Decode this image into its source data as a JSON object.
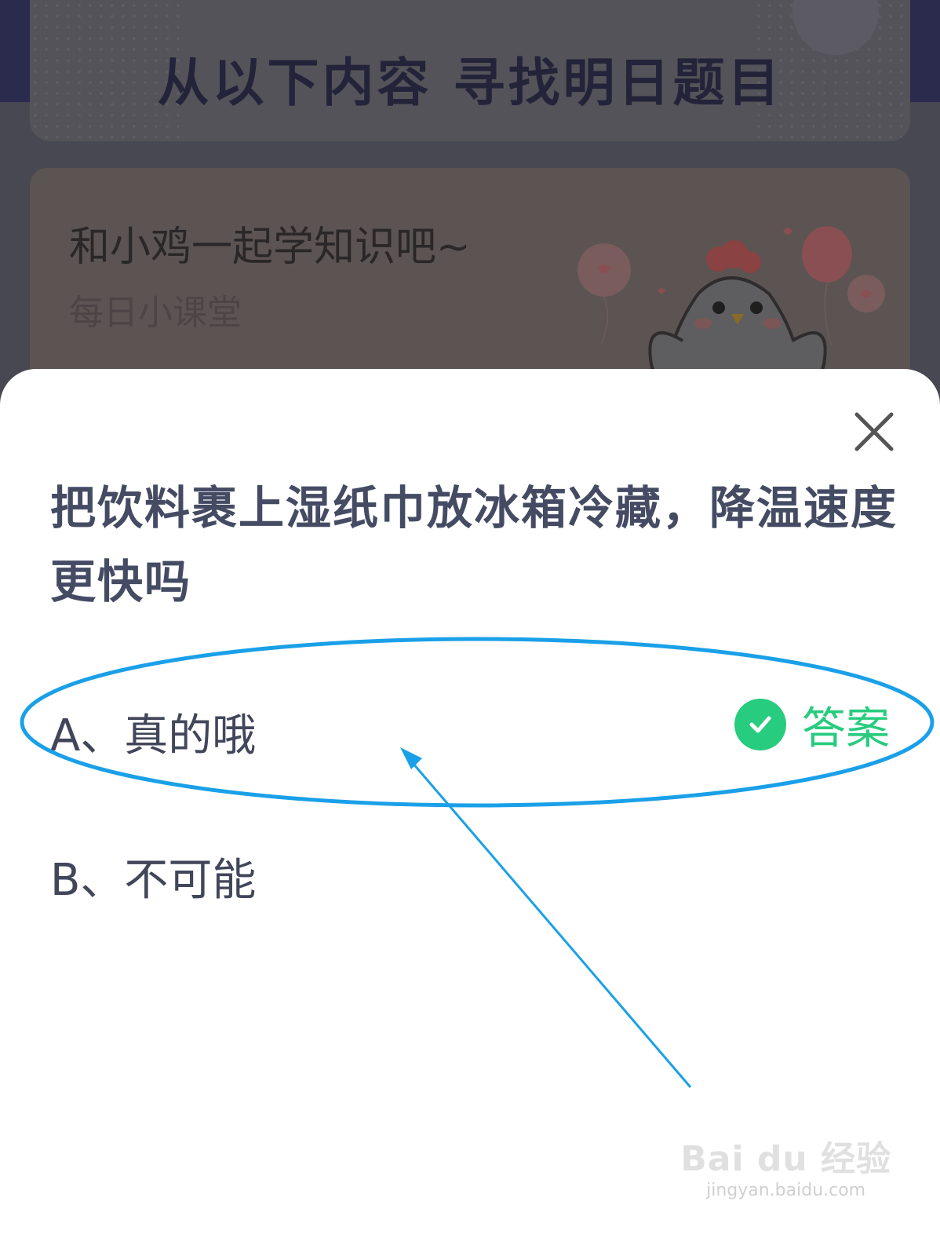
{
  "background": {
    "header_title": "从以下内容  寻找明日题目",
    "course_title": "和小鸡一起学知识吧~",
    "course_subtitle": "每日小课堂"
  },
  "sheet": {
    "question": "把饮料裹上湿纸巾放冰箱冷藏，降温速度更快吗",
    "options": [
      {
        "label": "A、真的哦",
        "is_answer": true
      },
      {
        "label": "B、不可能",
        "is_answer": false
      }
    ],
    "answer_badge": "答案"
  },
  "watermark": {
    "brand": "Bai du 经验",
    "domain": "jingyan.baidu.com"
  },
  "colors": {
    "answer_green": "#27cc7e",
    "question_text": "#444b63",
    "annotation_blue": "#1aa0e8"
  },
  "icons": {
    "close": "close-icon",
    "answer_check": "check-icon"
  }
}
